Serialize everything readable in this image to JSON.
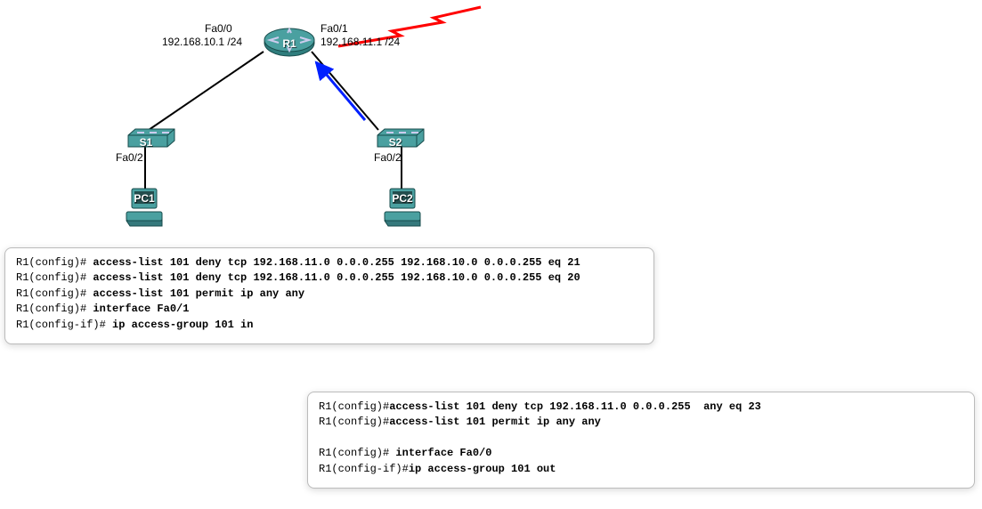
{
  "diagram": {
    "router": {
      "label": "R1",
      "if_left": "Fa0/0",
      "ip_left": "192.168.10.1 /24",
      "if_right": "Fa0/1",
      "ip_right": "192.168.11.1 /24"
    },
    "switches": {
      "s1": {
        "label": "S1",
        "port": "Fa0/2"
      },
      "s2": {
        "label": "S2",
        "port": "Fa0/2"
      }
    },
    "pcs": {
      "pc1": {
        "label": "PC1"
      },
      "pc2": {
        "label": "PC2"
      }
    }
  },
  "cli_a": {
    "lines": [
      {
        "prompt": "R1(config)# ",
        "cmd": "access-list 101 deny tcp 192.168.11.0 0.0.0.255 192.168.10.0 0.0.0.255 eq 21"
      },
      {
        "prompt": "R1(config)# ",
        "cmd": "access-list 101 deny tcp 192.168.11.0 0.0.0.255 192.168.10.0 0.0.0.255 eq 20"
      },
      {
        "prompt": "R1(config)# ",
        "cmd": "access-list 101 permit ip any any"
      },
      {
        "prompt": "R1(config)# ",
        "cmd": "interface Fa0/1"
      },
      {
        "prompt": "R1(config-if)# ",
        "cmd": "ip access-group 101 in"
      }
    ]
  },
  "cli_b": {
    "lines": [
      {
        "prompt": "R1(config)#",
        "cmd": "access-list 101 deny tcp 192.168.11.0 0.0.0.255  any eq 23"
      },
      {
        "prompt": "R1(config)#",
        "cmd": "access-list 101 permit ip any any"
      },
      {
        "prompt": "",
        "cmd": ""
      },
      {
        "prompt": "R1(config)# ",
        "cmd": "interface Fa0/0"
      },
      {
        "prompt": "R1(config-if)#",
        "cmd": "ip access-group 101 out"
      }
    ]
  }
}
